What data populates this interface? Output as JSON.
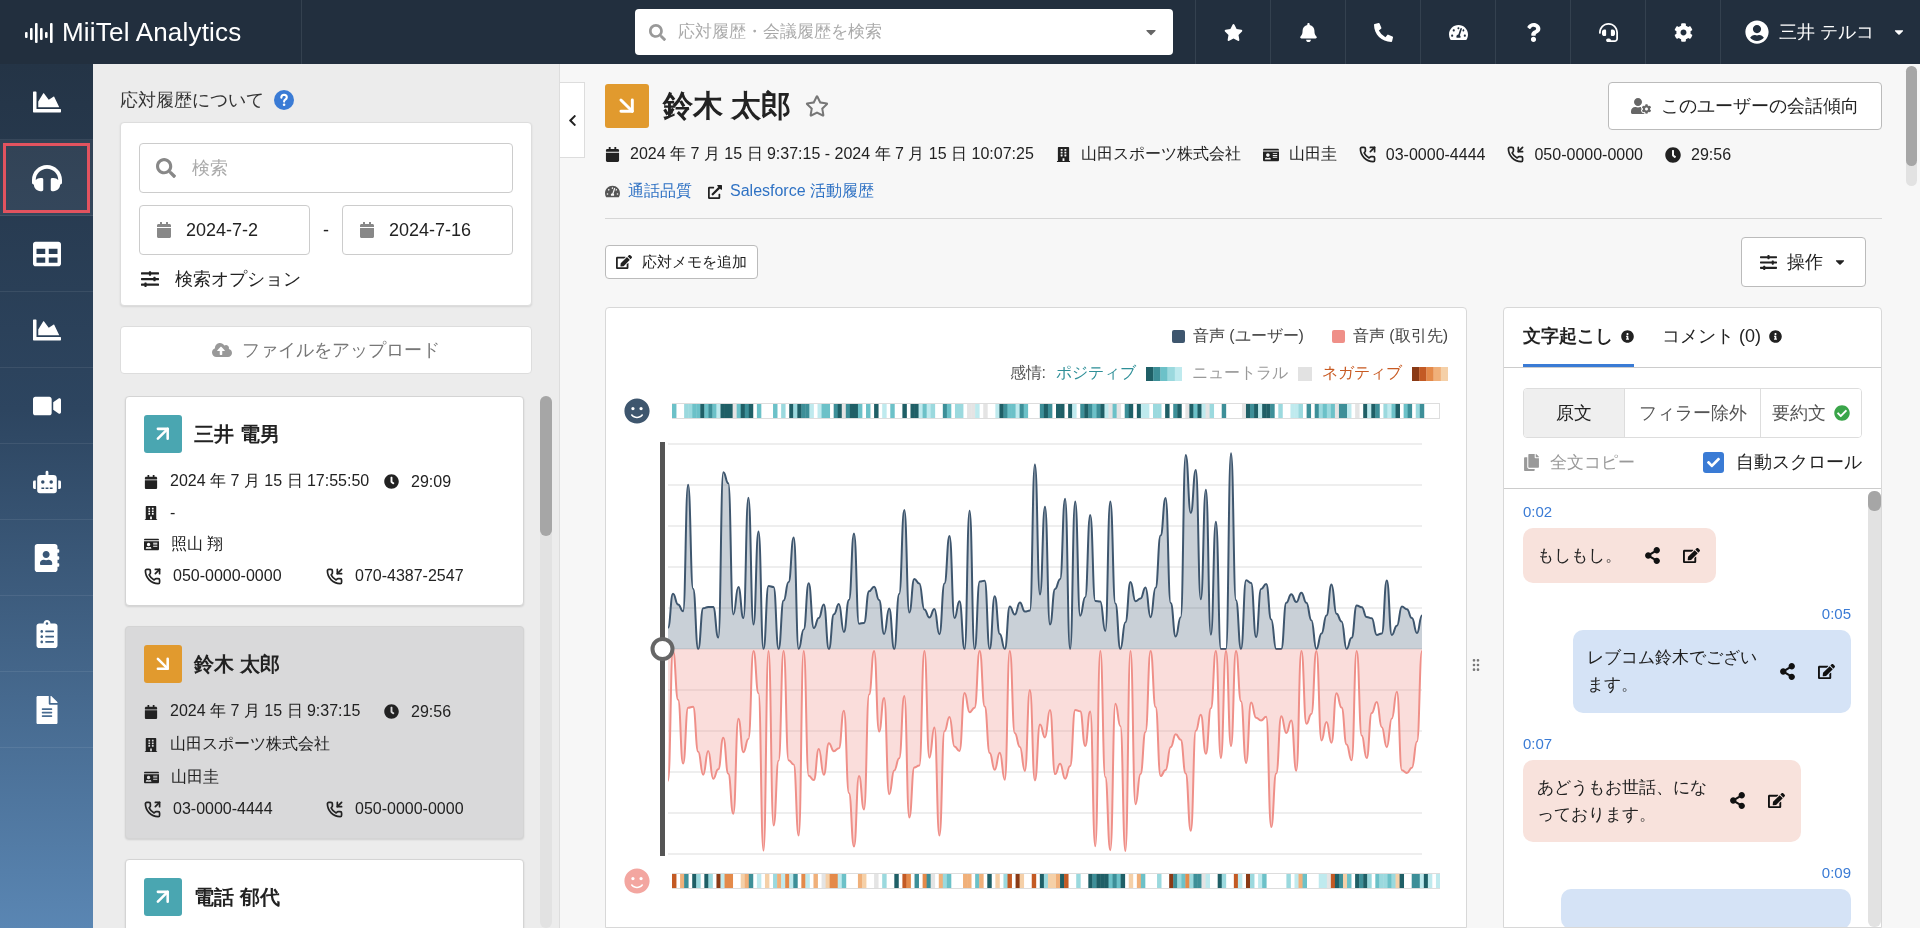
{
  "app": {
    "logo": "MiiTel Analytics",
    "search": {
      "placeholder": "応対履歴・会議履歴を検索"
    },
    "user": {
      "name": "三井 テルコ"
    }
  },
  "nav": {
    "items": [
      {
        "selected": false
      },
      {
        "selected": true
      },
      {
        "selected": false
      },
      {
        "selected": false
      },
      {
        "selected": false
      },
      {
        "selected": false
      },
      {
        "selected": false
      },
      {
        "selected": false
      },
      {
        "selected": false
      }
    ]
  },
  "history": {
    "title": "応対履歴について",
    "search": {
      "placeholder": "検索"
    },
    "date_from": "2024-7-2",
    "date_separator": "-",
    "date_to": "2024-7-16",
    "options_label": "検索オプション",
    "upload_label": "ファイルをアップロード",
    "calls": [
      {
        "kind": "outgoing",
        "selected": false,
        "name": "三井 電男",
        "datetime": "2024 年 7 月 15 日 17:55:50",
        "duration": "29:09",
        "company": "-",
        "contact": "照山 翔",
        "phone_from": "050-0000-0000",
        "phone_to": "070-4387-2547"
      },
      {
        "kind": "incoming",
        "selected": true,
        "name": "鈴木 太郎",
        "datetime": "2024 年 7 月 15 日 9:37:15",
        "duration": "29:56",
        "company": "山田スポーツ株式会社",
        "contact": "山田圭",
        "phone_from": "03-0000-4444",
        "phone_to": "050-0000-0000"
      },
      {
        "kind": "outgoing",
        "selected": false,
        "name": "電話 郁代"
      }
    ]
  },
  "detail": {
    "kind": "incoming",
    "name": "鈴木 太郎",
    "starred": false,
    "trend_button": "このユーザーの会話傾向",
    "datetime": "2024 年 7 月 15 日 9:37:15 - 2024 年 7 月 15 日 10:07:25",
    "company": "山田スポーツ株式会社",
    "contact": "山田圭",
    "phone_from": "03-0000-4444",
    "phone_to": "050-0000-0000",
    "duration": "29:56",
    "links": [
      {
        "kind": "quality",
        "label": "通話品質"
      },
      {
        "kind": "external",
        "label": "Salesforce 活動履歴"
      }
    ],
    "memo_button": "応対メモを追加",
    "actions_button": "操作"
  },
  "chart_panel": {
    "legend": [
      {
        "label": "音声 (ユーザー)",
        "color": "#3e566e"
      },
      {
        "label": "音声 (取引先)",
        "color": "#ef8f88"
      }
    ],
    "sentiment_label": "感情:",
    "sentiment": [
      {
        "kind": "positive",
        "label": "ポジティブ"
      },
      {
        "kind": "neutral",
        "label": "ニュートラル"
      },
      {
        "kind": "negative",
        "label": "ネガティブ"
      }
    ]
  },
  "transcript": {
    "tabs": [
      {
        "label": "文字起こし",
        "selected": true
      },
      {
        "label": "コメント (0)",
        "selected": false
      }
    ],
    "modes": [
      {
        "label": "原文",
        "selected": true,
        "done": false
      },
      {
        "label": "フィラー除外",
        "selected": false,
        "done": false
      },
      {
        "label": "要約文",
        "selected": false,
        "done": true
      }
    ],
    "copy_label": "全文コピー",
    "auto_scroll": {
      "label": "自動スクロール",
      "checked": true
    },
    "messages": [
      {
        "kind": "customer",
        "time": "0:02",
        "text": "もしもし。"
      },
      {
        "kind": "user",
        "time": "0:05",
        "text": "レブコム鈴木でございます。"
      },
      {
        "kind": "customer",
        "time": "0:07",
        "text": "あどうもお世話、になっております。"
      },
      {
        "kind": "user",
        "time": "0:09"
      }
    ]
  }
}
